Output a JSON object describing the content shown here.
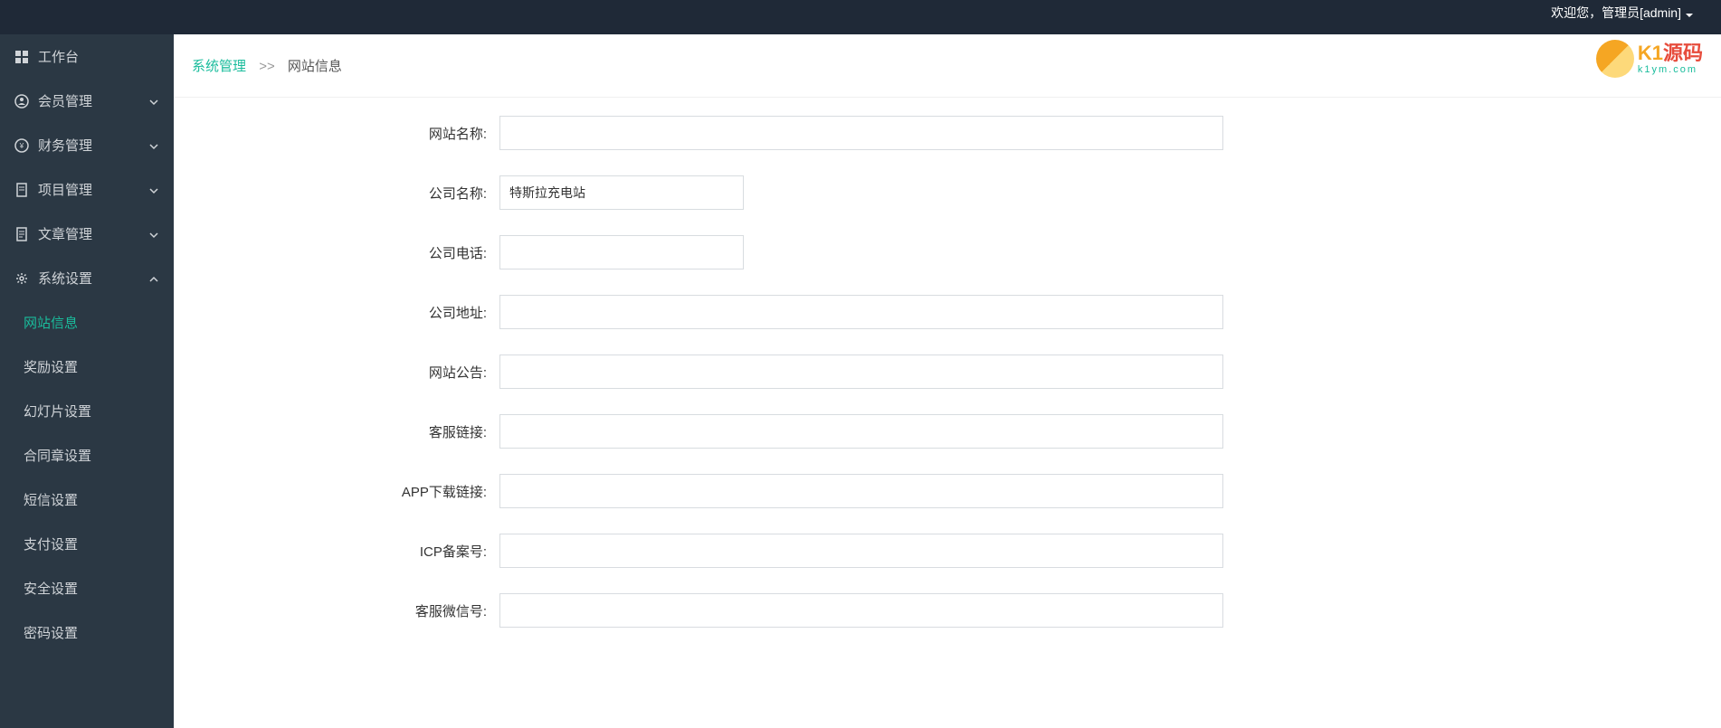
{
  "topbar": {
    "welcome": "欢迎您，管理员[admin]"
  },
  "sidebar": {
    "items": [
      {
        "label": "工作台"
      },
      {
        "label": "会员管理"
      },
      {
        "label": "财务管理"
      },
      {
        "label": "项目管理"
      },
      {
        "label": "文章管理"
      },
      {
        "label": "系统设置"
      }
    ],
    "subitems": [
      {
        "label": "网站信息"
      },
      {
        "label": "奖励设置"
      },
      {
        "label": "幻灯片设置"
      },
      {
        "label": "合同章设置"
      },
      {
        "label": "短信设置"
      },
      {
        "label": "支付设置"
      },
      {
        "label": "安全设置"
      },
      {
        "label": "密码设置"
      }
    ]
  },
  "breadcrumb": {
    "link": "系统管理",
    "sep": ">>",
    "current": "网站信息"
  },
  "form": {
    "fields": [
      {
        "label": "网站名称:",
        "value": ""
      },
      {
        "label": "公司名称:",
        "value": "特斯拉充电站"
      },
      {
        "label": "公司电话:",
        "value": ""
      },
      {
        "label": "公司地址:",
        "value": ""
      },
      {
        "label": "网站公告:",
        "value": ""
      },
      {
        "label": "客服链接:",
        "value": ""
      },
      {
        "label": "APP下载链接:",
        "value": ""
      },
      {
        "label": "ICP备案号:",
        "value": ""
      },
      {
        "label": "客服微信号:",
        "value": ""
      }
    ]
  },
  "logo": {
    "main1": "K1",
    "main2": "源码",
    "sub": "k1ym.com"
  }
}
